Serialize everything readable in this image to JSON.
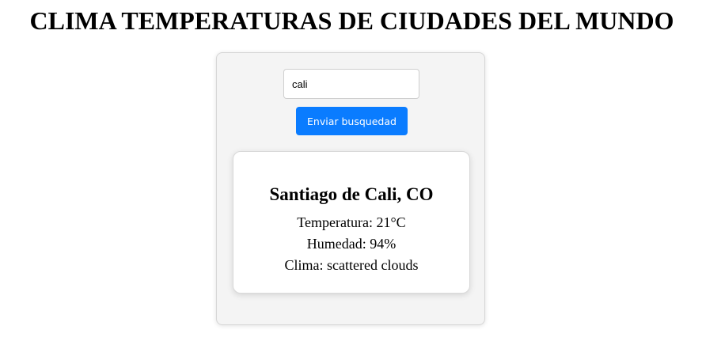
{
  "page": {
    "title": "CLIMA TEMPERATURAS DE CIUDADES DEL MUNDO"
  },
  "search": {
    "value": "cali",
    "button_label": "Enviar busquedad"
  },
  "result": {
    "city": "Santiago de Cali, CO",
    "temperature": "Temperatura: 21°C",
    "humidity": "Humedad: 94%",
    "weather": "Clima: scattered clouds"
  },
  "colors": {
    "accent": "#0a7cff",
    "panel_background": "#f4f4f4",
    "card_background": "#ffffff"
  }
}
